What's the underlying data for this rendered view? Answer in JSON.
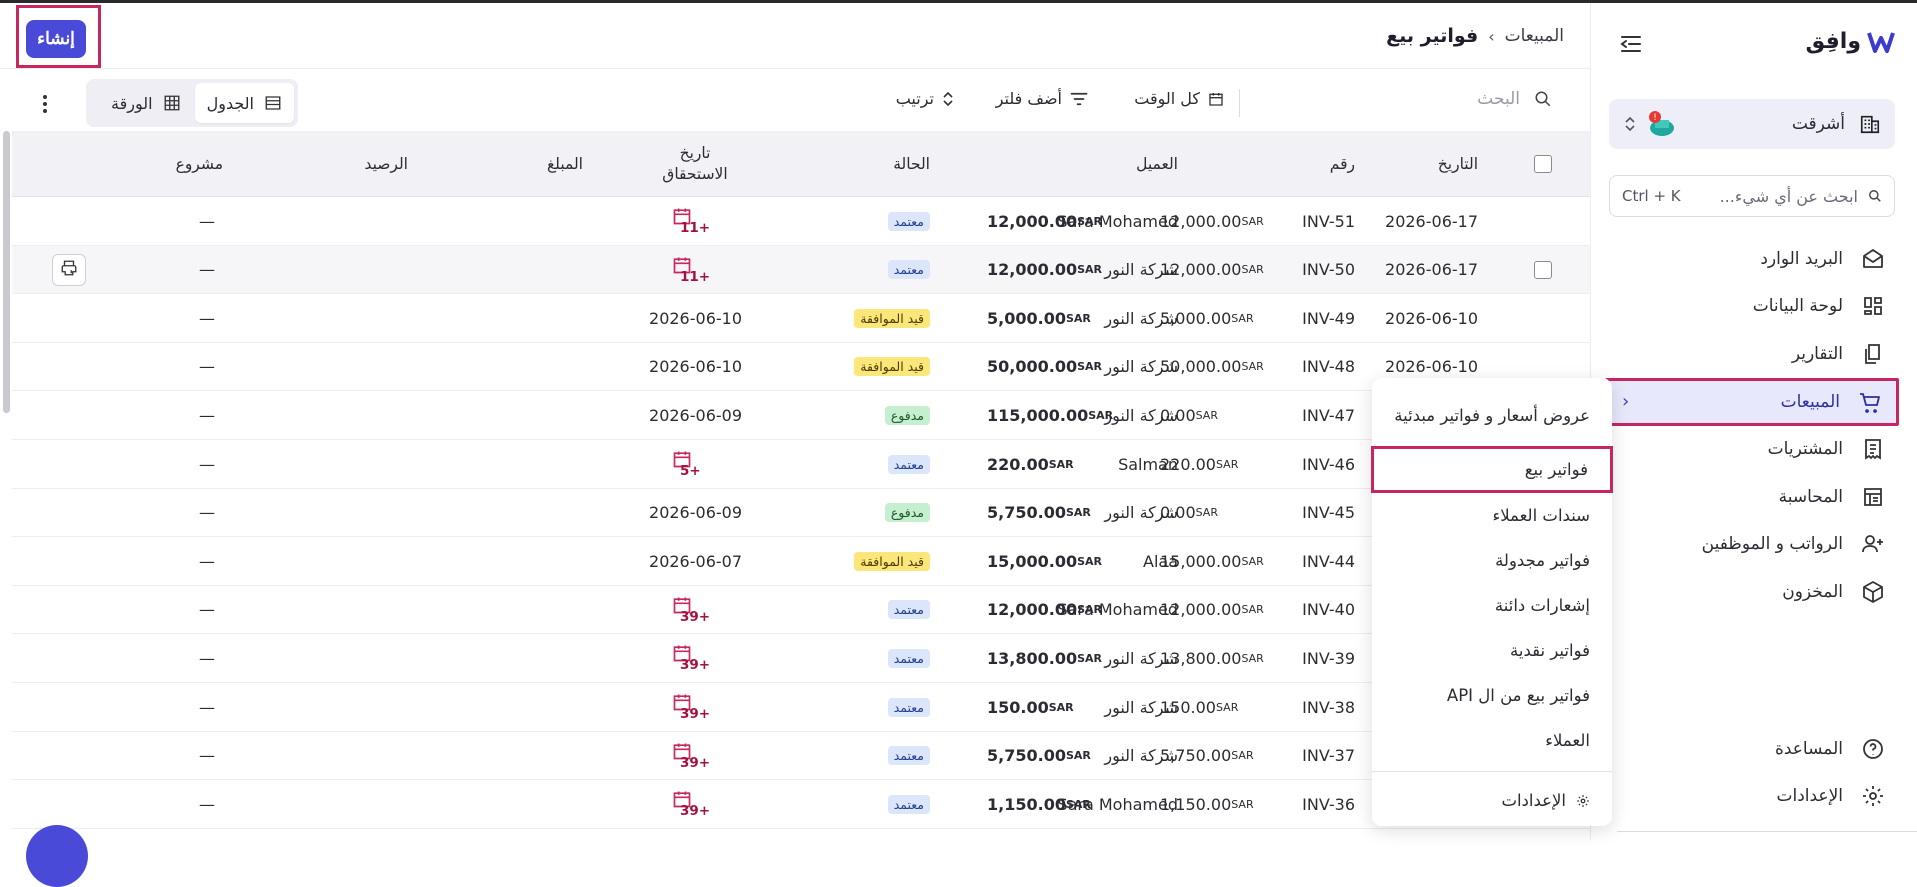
{
  "sidebar": {
    "logo_text": "وافِق",
    "org_name": "أشرقت",
    "search_placeholder": "ابحث عن أي شيء...",
    "search_shortcut": "Ctrl + K",
    "items": [
      {
        "label": "البريد الوارد",
        "icon": "inbox-icon"
      },
      {
        "label": "لوحة البيانات",
        "icon": "dashboard-icon"
      },
      {
        "label": "التقارير",
        "icon": "reports-icon"
      },
      {
        "label": "المبيعات",
        "icon": "cart-icon"
      },
      {
        "label": "المشتريات",
        "icon": "receipt-icon"
      },
      {
        "label": "المحاسبة",
        "icon": "ledger-icon"
      },
      {
        "label": "الرواتب و الموظفين",
        "icon": "people-icon"
      },
      {
        "label": "المخزون",
        "icon": "box-icon"
      }
    ],
    "bottom": [
      {
        "label": "المساعدة",
        "icon": "help-icon"
      },
      {
        "label": "الإعدادات",
        "icon": "gear-icon"
      }
    ]
  },
  "header": {
    "crumb_parent": "المبيعات",
    "crumb_sep": "›",
    "title": "فواتير بيع",
    "create_label": "إنشاء"
  },
  "toolbar": {
    "search_placeholder": "البحث",
    "time_label": "كل الوقت",
    "filter_label": "أضف فلتر",
    "sort_label": "ترتيب",
    "view_table": "الجدول",
    "view_sheet": "الورقة"
  },
  "table": {
    "columns": [
      "التاريخ",
      "رقم",
      "العميل",
      "الحالة",
      "تاريخ الاستحقاق",
      "المبلغ",
      "الرصيد",
      "مشروع"
    ],
    "currency": "SAR",
    "rows": [
      {
        "date": "2026-06-17",
        "num": "INV-51",
        "client": "Sara Mohamed",
        "status": "معتمد",
        "stype": "approved",
        "due": "+11",
        "due_icon": true,
        "amount": "12,000.00",
        "balance": "12,000.00",
        "project": "—"
      },
      {
        "date": "2026-06-17",
        "num": "INV-50",
        "client": "شركة النور",
        "status": "معتمد",
        "stype": "approved",
        "due": "+11",
        "due_icon": true,
        "amount": "12,000.00",
        "balance": "12,000.00",
        "project": "—"
      },
      {
        "date": "2026-06-10",
        "num": "INV-49",
        "client": "شركة النور",
        "status": "قيد الموافقة",
        "stype": "pending",
        "due": "2026-06-10",
        "due_icon": false,
        "amount": "5,000.00",
        "balance": "5,000.00",
        "project": "—"
      },
      {
        "date": "2026-06-10",
        "num": "INV-48",
        "client": "شركة النور",
        "status": "قيد الموافقة",
        "stype": "pending",
        "due": "2026-06-10",
        "due_icon": false,
        "amount": "50,000.00",
        "balance": "50,000.00",
        "project": "—"
      },
      {
        "date": "",
        "num": "INV-47",
        "client": "شركة النور",
        "status": "مدفوع",
        "stype": "paid",
        "due": "2026-06-09",
        "due_icon": false,
        "amount": "115,000.00",
        "balance": "0.00",
        "project": "—"
      },
      {
        "date": "",
        "num": "INV-46",
        "client": "Salman",
        "status": "معتمد",
        "stype": "approved",
        "due": "+5",
        "due_icon": true,
        "amount": "220.00",
        "balance": "220.00",
        "project": "—"
      },
      {
        "date": "",
        "num": "INV-45",
        "client": "شركة النور",
        "status": "مدفوع",
        "stype": "paid",
        "due": "2026-06-09",
        "due_icon": false,
        "amount": "5,750.00",
        "balance": "0.00",
        "project": "—"
      },
      {
        "date": "",
        "num": "INV-44",
        "client": "Alaa",
        "status": "قيد الموافقة",
        "stype": "pending",
        "due": "2026-06-07",
        "due_icon": false,
        "amount": "15,000.00",
        "balance": "15,000.00",
        "project": "—"
      },
      {
        "date": "",
        "num": "INV-40",
        "client": "Sara Mohamed",
        "status": "معتمد",
        "stype": "approved",
        "due": "+39",
        "due_icon": true,
        "amount": "12,000.00",
        "balance": "12,000.00",
        "project": "—"
      },
      {
        "date": "",
        "num": "INV-39",
        "client": "شركة النور",
        "status": "معتمد",
        "stype": "approved",
        "due": "+39",
        "due_icon": true,
        "amount": "13,800.00",
        "balance": "13,800.00",
        "project": "—"
      },
      {
        "date": "",
        "num": "INV-38",
        "client": "شركة النور",
        "status": "معتمد",
        "stype": "approved",
        "due": "+39",
        "due_icon": true,
        "amount": "150.00",
        "balance": "150.00",
        "project": "—"
      },
      {
        "date": "",
        "num": "INV-37",
        "client": "شركة النور",
        "status": "معتمد",
        "stype": "approved",
        "due": "+39",
        "due_icon": true,
        "amount": "5,750.00",
        "balance": "5,750.00",
        "project": "—"
      },
      {
        "date": "",
        "num": "INV-36",
        "client": "Sara Mohamed",
        "status": "معتمد",
        "stype": "approved",
        "due": "+39",
        "due_icon": true,
        "amount": "1,150.00",
        "balance": "1,150.00",
        "project": "—"
      }
    ]
  },
  "sales_menu": {
    "items": [
      "عروض أسعار و فواتير مبدئية",
      "فواتير بيع",
      "سندات العملاء",
      "فواتير مجدولة",
      "إشعارات دائنة",
      "فواتير نقدية",
      "فواتير بيع من ال API",
      "العملاء"
    ],
    "settings_label": "الإعدادات"
  },
  "colors": {
    "accent": "#4a4ad8",
    "highlight": "#c8265e",
    "active_bg": "#e7e8fb"
  }
}
